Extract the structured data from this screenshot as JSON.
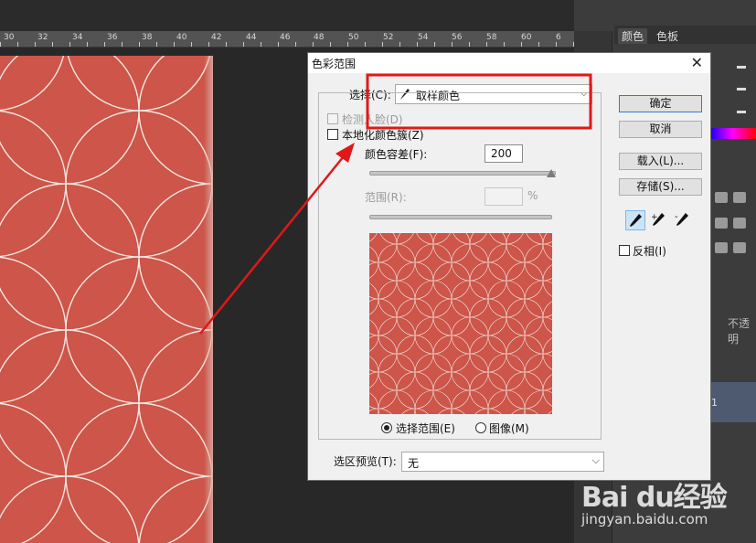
{
  "ruler": {
    "ticks": [
      "30",
      "32",
      "34",
      "36",
      "38",
      "40",
      "42",
      "44",
      "46",
      "48",
      "50",
      "52",
      "54",
      "56",
      "58",
      "60",
      "6"
    ]
  },
  "panels": {
    "tab_color": "颜色",
    "tab_swatches": "色板",
    "opacity_label": "不透明",
    "layer_num": "1"
  },
  "dialog": {
    "title": "色彩范围",
    "select_label": "选择(C):",
    "select_value": "取样颜色",
    "detect_faces_label": "检测人脸(D)",
    "localized_clusters_label": "本地化颜色簇(Z)",
    "fuzziness_label": "颜色容差(F):",
    "fuzziness_value": "200",
    "range_label": "范围(R):",
    "range_value": "",
    "range_unit": "%",
    "radio_selection": "选择范围(E)",
    "radio_image": "图像(M)",
    "preview_label": "选区预览(T):",
    "preview_value": "无",
    "ok_button": "确定",
    "cancel_button": "取消",
    "load_button": "载入(L)...",
    "save_button": "存储(S)...",
    "invert_label": "反相(I)",
    "sample_dropper": "eyedropper-icon",
    "add_dropper": "eyedropper-plus-icon",
    "subtract_dropper": "eyedropper-minus-icon"
  },
  "colors": {
    "pattern_red": "#cd5549",
    "pattern_bg": "#e6e4e1",
    "annotation_red": "#e01818",
    "dialog_bg": "#f0f0f0"
  },
  "watermark": {
    "logo": "Bai du经验",
    "url": "jingyan.baidu.com"
  }
}
